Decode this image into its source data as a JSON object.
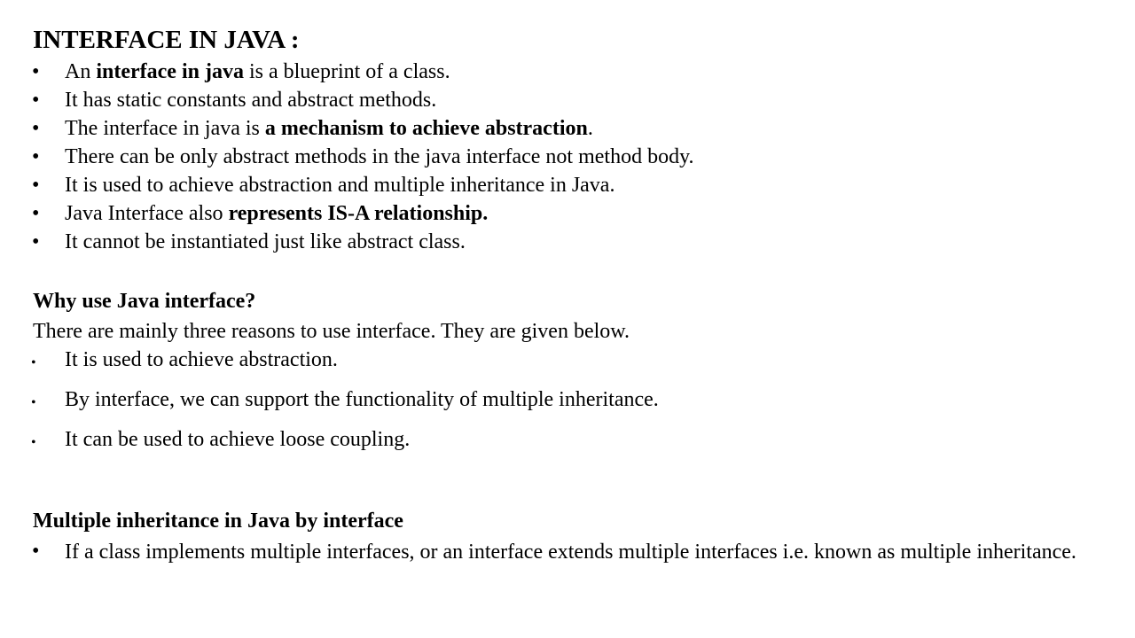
{
  "title": "INTERFACE IN JAVA :",
  "section1": {
    "bullets": [
      {
        "pre": "An ",
        "bold": "interface in java",
        "post": " is a blueprint of a class."
      },
      {
        "pre": "It has static constants and abstract methods.",
        "bold": "",
        "post": ""
      },
      {
        "pre": "The interface in java is ",
        "bold": "a mechanism to achieve abstraction",
        "post": "."
      },
      {
        "pre": "There can be only abstract methods in the java interface not method body.",
        "bold": "",
        "post": ""
      },
      {
        "pre": "It is used to achieve abstraction and multiple inheritance in Java.",
        "bold": "",
        "post": ""
      },
      {
        "pre": "Java Interface also ",
        "bold": "represents IS-A relationship.",
        "post": ""
      },
      {
        "pre": "It cannot be instantiated just like abstract class.",
        "bold": "",
        "post": ""
      }
    ]
  },
  "section2": {
    "heading": "Why use Java interface?",
    "intro": "There are mainly three reasons to use interface. They are given below.",
    "bullets": [
      "It is used to achieve abstraction.",
      "By interface, we can support the functionality of multiple inheritance.",
      "It can be used to achieve loose coupling."
    ]
  },
  "section3": {
    "heading": "Multiple inheritance in Java by interface",
    "bullets": [
      "If a class implements multiple interfaces, or an interface extends multiple interfaces i.e. known as multiple inheritance."
    ]
  },
  "bullet_glyph": "•"
}
